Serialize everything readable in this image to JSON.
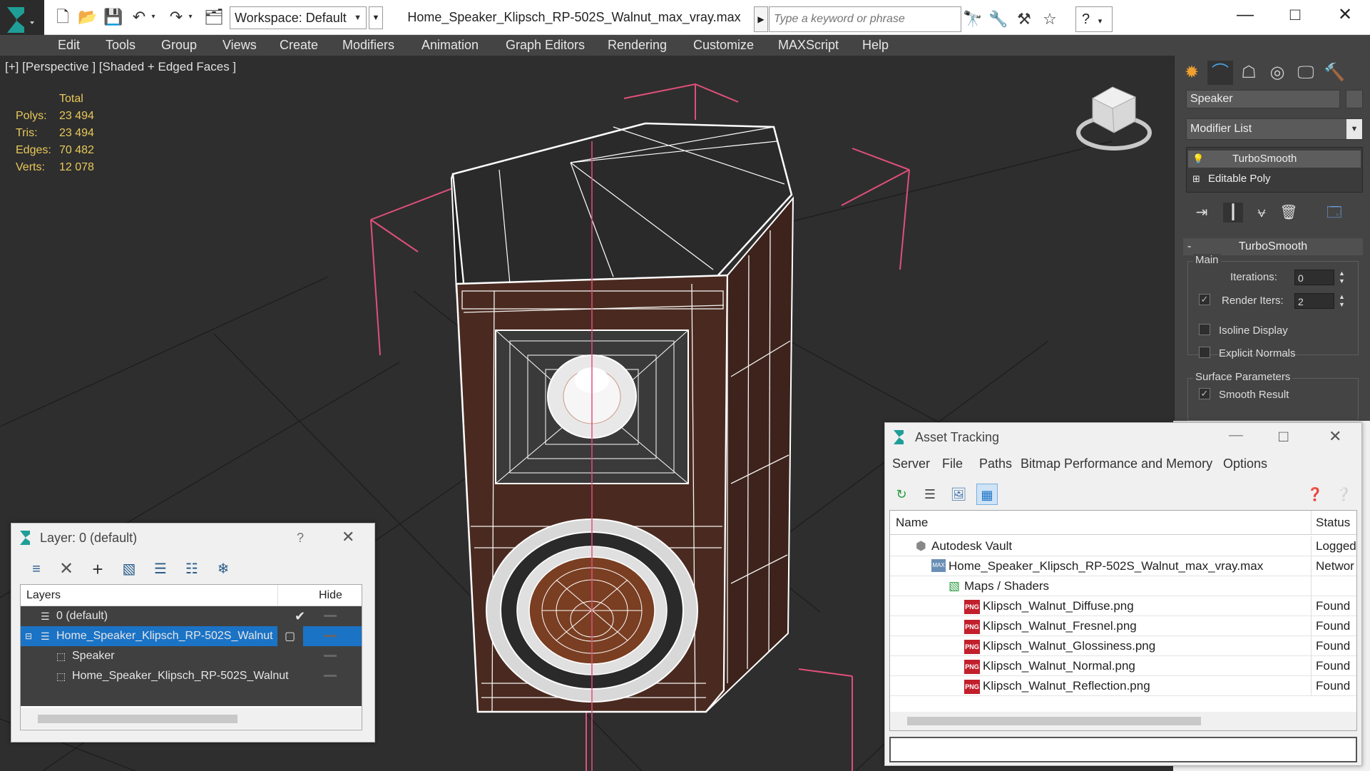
{
  "titlebar": {
    "workspace": "Workspace: Default",
    "file_title": "Home_Speaker_Klipsch_RP-502S_Walnut_max_vray.max",
    "search_placeholder": "Type a keyword or phrase",
    "help_glyph": "?"
  },
  "menu": [
    "Edit",
    "Tools",
    "Group",
    "Views",
    "Create",
    "Modifiers",
    "Animation",
    "Graph Editors",
    "Rendering",
    "Customize",
    "MAXScript",
    "Help"
  ],
  "viewport": {
    "label": "[+] [Perspective ] [Shaded + Edged Faces ]",
    "stats_header": "Total",
    "stats": [
      {
        "label": "Polys:",
        "value": "23 494"
      },
      {
        "label": "Tris:",
        "value": "23 494"
      },
      {
        "label": "Edges:",
        "value": "70 482"
      },
      {
        "label": "Verts:",
        "value": "12 078"
      }
    ]
  },
  "command_panel": {
    "object_name": "Speaker",
    "modifier_list": "Modifier List",
    "stack": [
      {
        "label": "TurboSmooth",
        "selected": true
      },
      {
        "label": "Editable Poly",
        "selected": false
      }
    ],
    "turbosmooth": {
      "title": "TurboSmooth",
      "main_group": "Main",
      "iterations_label": "Iterations:",
      "iterations_value": "0",
      "render_iters_label": "Render Iters:",
      "render_iters_value": "2",
      "render_iters_checked": true,
      "isoline_label": "Isoline Display",
      "explicit_normals_label": "Explicit Normals",
      "surface_group": "Surface Parameters",
      "smooth_result_label": "Smooth Result",
      "smooth_result_checked": true
    }
  },
  "layer_window": {
    "title": "Layer: 0 (default)",
    "help": "?",
    "col_layers": "Layers",
    "col_hide": "Hide",
    "rows": [
      {
        "label": "0 (default)",
        "selected": false,
        "active": true
      },
      {
        "label": "Home_Speaker_Klipsch_RP-502S_Walnut",
        "selected": true,
        "active": false
      },
      {
        "label": "Speaker",
        "selected": false,
        "active": false
      },
      {
        "label": "Home_Speaker_Klipsch_RP-502S_Walnut",
        "selected": false,
        "active": false
      }
    ]
  },
  "asset_window": {
    "title": "Asset Tracking",
    "menu": [
      "Server",
      "File",
      "Paths",
      "Bitmap Performance and Memory",
      "Options"
    ],
    "col_name": "Name",
    "col_status": "Status",
    "rows": [
      {
        "name": "Autodesk Vault",
        "status": "Logged",
        "icon": "vault-icon",
        "indent": 1
      },
      {
        "name": "Home_Speaker_Klipsch_RP-502S_Walnut_max_vray.max",
        "status": "Networ",
        "icon": "max-file-icon",
        "indent": 2
      },
      {
        "name": "Maps / Shaders",
        "status": "",
        "icon": "maps-icon",
        "indent": 3
      },
      {
        "name": "Klipsch_Walnut_Diffuse.png",
        "status": "Found",
        "icon": "png-icon",
        "indent": 4
      },
      {
        "name": "Klipsch_Walnut_Fresnel.png",
        "status": "Found",
        "icon": "png-icon",
        "indent": 4
      },
      {
        "name": "Klipsch_Walnut_Glossiness.png",
        "status": "Found",
        "icon": "png-icon",
        "indent": 4
      },
      {
        "name": "Klipsch_Walnut_Normal.png",
        "status": "Found",
        "icon": "png-icon",
        "indent": 4
      },
      {
        "name": "Klipsch_Walnut_Reflection.png",
        "status": "Found",
        "icon": "png-icon",
        "indent": 4
      }
    ]
  },
  "colors": {
    "viewport_bg": "#2e2e2e",
    "menubar_bg": "#444444",
    "stats_text": "#e8c95a",
    "selection": "#1b73c6",
    "bounding_box": "#e0507a",
    "walnut": "#4a2a20"
  }
}
